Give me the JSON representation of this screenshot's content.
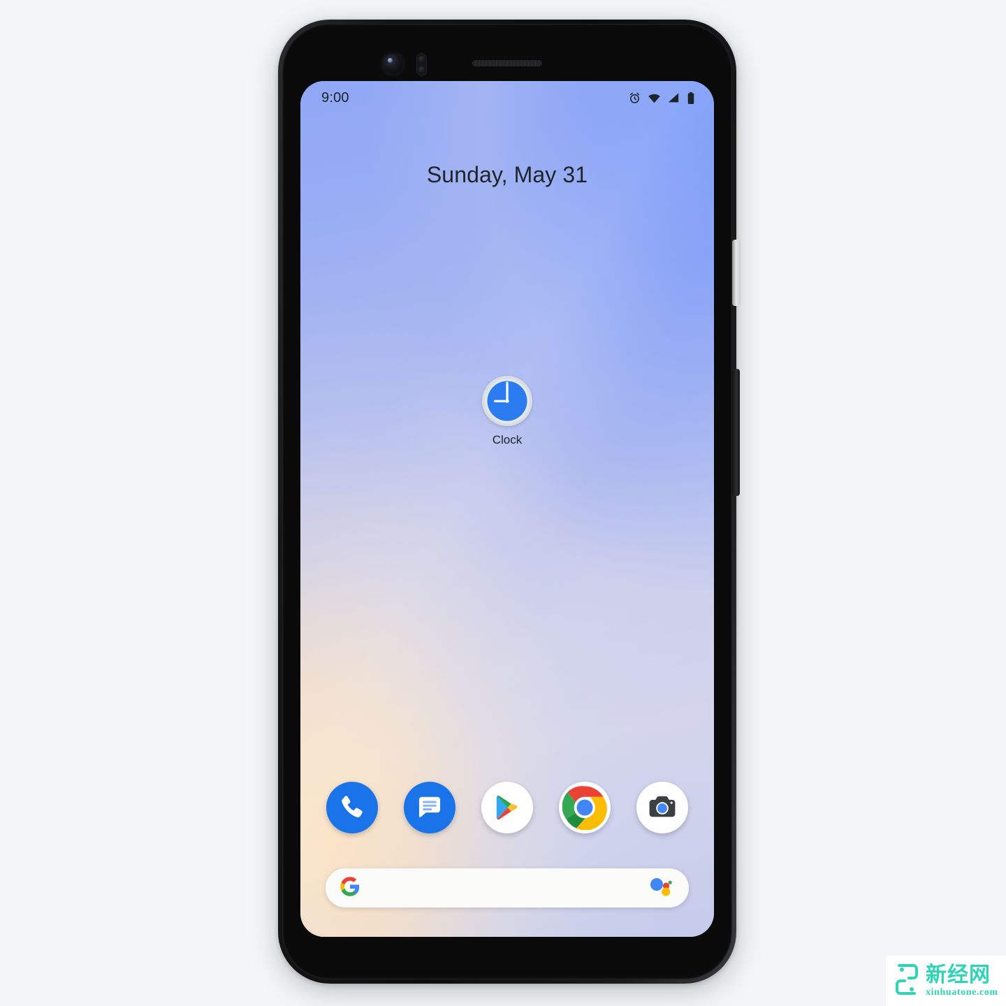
{
  "device": {
    "name": "Google Pixel 4 smartphone",
    "hardware": {
      "front_camera": "front-camera",
      "sensor": "proximity-sensor",
      "earpiece": "earpiece-speaker",
      "power_button": "power-button",
      "volume_button": "volume-rocker"
    }
  },
  "status_bar": {
    "time": "9:00",
    "icons": [
      "alarm-icon",
      "wifi-icon",
      "cellular-signal-icon",
      "battery-icon"
    ]
  },
  "home_screen": {
    "date_widget": {
      "text": "Sunday, May 31"
    },
    "apps": [
      {
        "label": "Clock",
        "icon": "clock-icon",
        "time_shown": "9:00"
      }
    ],
    "dock": [
      {
        "label": "Phone",
        "icon": "phone-icon",
        "bg": "#1a73e8"
      },
      {
        "label": "Messages",
        "icon": "messages-icon",
        "bg": "#1a73e8"
      },
      {
        "label": "Play Store",
        "icon": "play-store-icon",
        "bg": "#ffffff"
      },
      {
        "label": "Chrome",
        "icon": "chrome-icon",
        "bg": "#ffffff"
      },
      {
        "label": "Camera",
        "icon": "camera-icon",
        "bg": "#ffffff"
      }
    ],
    "search_bar": {
      "placeholder": "",
      "value": "",
      "left_icon": "google-g-icon",
      "right_icon": "google-assistant-icon"
    }
  },
  "watermark": {
    "text_cn": "新经网",
    "url": "xinhuatone.com",
    "color": "#2fd3b5"
  },
  "colors": {
    "page_background": "#f4f5f7",
    "accent_blue": "#1a73e8",
    "wallpaper_top": "#8fa7f5",
    "wallpaper_bottom_left": "#fce2be",
    "status_text": "#1d232b"
  }
}
